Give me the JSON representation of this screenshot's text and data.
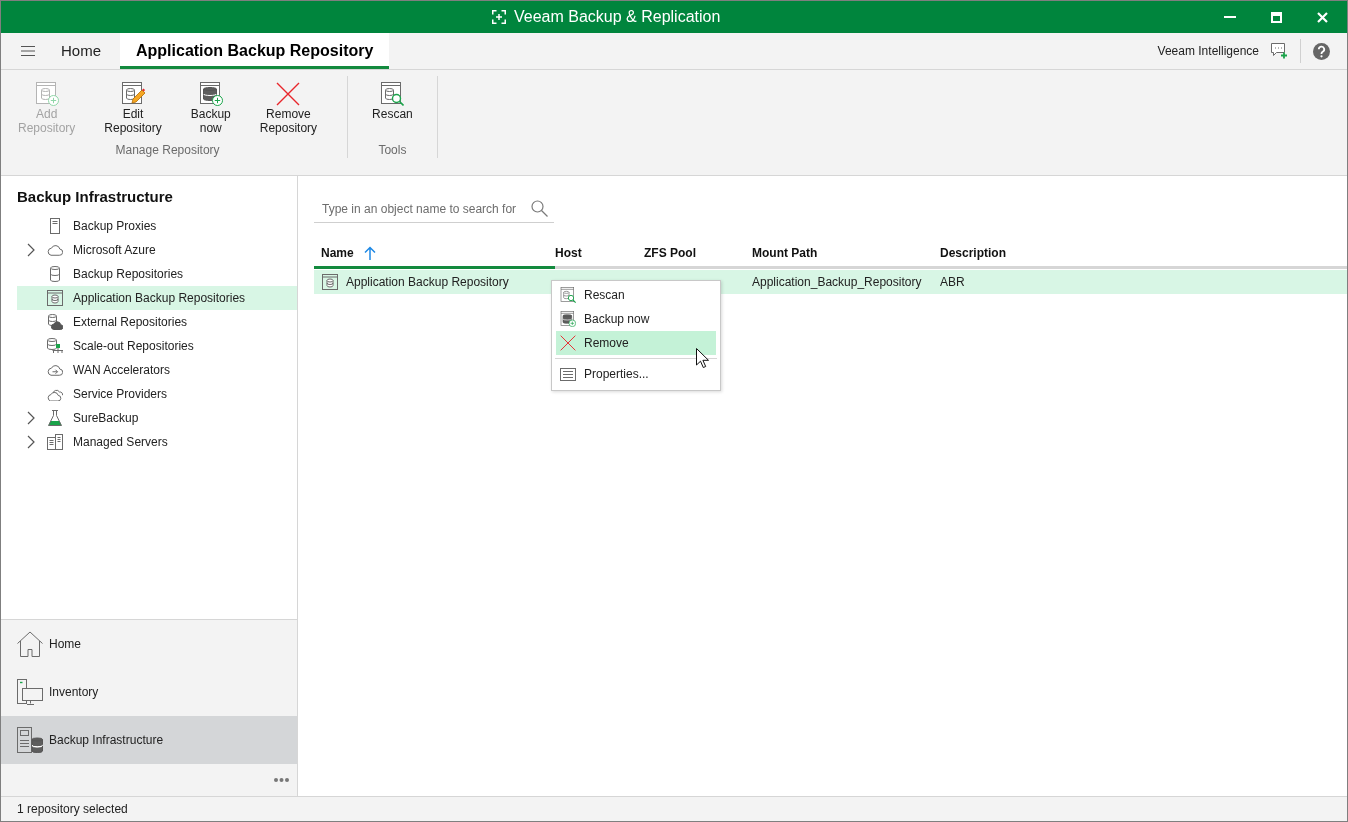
{
  "window": {
    "title": "Veeam Backup & Replication"
  },
  "ribbon_tabs": [
    {
      "label": "Home",
      "selected": false
    },
    {
      "label": "Application Backup Repository",
      "selected": true
    }
  ],
  "assistant": {
    "label": "Veeam Intelligence"
  },
  "ribbon": {
    "groups": [
      {
        "label": "Manage Repository",
        "buttons": [
          {
            "label": "Add Repository",
            "disabled": true
          },
          {
            "label": "Edit Repository",
            "disabled": false
          },
          {
            "label": "Backup now",
            "disabled": false
          },
          {
            "label": "Remove Repository",
            "disabled": false
          }
        ]
      },
      {
        "label": "Tools",
        "buttons": [
          {
            "label": "Rescan",
            "disabled": false
          }
        ]
      }
    ]
  },
  "sidebar": {
    "title": "Backup Infrastructure",
    "items": [
      {
        "label": "Backup Proxies",
        "selected": false
      },
      {
        "label": "Microsoft Azure",
        "selected": false,
        "expanded": false
      },
      {
        "label": "Backup Repositories",
        "selected": false
      },
      {
        "label": "Application Backup Repositories",
        "selected": true
      },
      {
        "label": "External Repositories",
        "selected": false
      },
      {
        "label": "Scale-out Repositories",
        "selected": false
      },
      {
        "label": "WAN Accelerators",
        "selected": false
      },
      {
        "label": "Service Providers",
        "selected": false
      },
      {
        "label": "SureBackup",
        "selected": false,
        "expanded": false
      },
      {
        "label": "Managed Servers",
        "selected": false,
        "expanded": false
      }
    ]
  },
  "navigation": [
    {
      "label": "Home",
      "selected": false
    },
    {
      "label": "Inventory",
      "selected": false
    },
    {
      "label": "Backup Infrastructure",
      "selected": true
    }
  ],
  "search": {
    "placeholder": "Type in an object name to search for"
  },
  "table": {
    "columns": [
      {
        "label": "Name",
        "sorted": true
      },
      {
        "label": "Host",
        "sorted": false
      },
      {
        "label": "ZFS Pool",
        "sorted": false
      },
      {
        "label": "Mount Path",
        "sorted": false
      },
      {
        "label": "Description",
        "sorted": false
      }
    ],
    "rows": [
      {
        "name": "Application Backup Repository",
        "mount_path": "Application_Backup_Repository",
        "description": "ABR",
        "selected": true
      }
    ]
  },
  "context_menu": {
    "groups": [
      {
        "items": [
          {
            "label": "Rescan",
            "selected": false
          },
          {
            "label": "Backup now",
            "selected": false
          },
          {
            "label": "Remove",
            "selected": true
          }
        ]
      },
      {
        "items": [
          {
            "label": "Properties...",
            "selected": false
          }
        ]
      }
    ]
  },
  "status_bar": {
    "text": "1 repository selected"
  }
}
